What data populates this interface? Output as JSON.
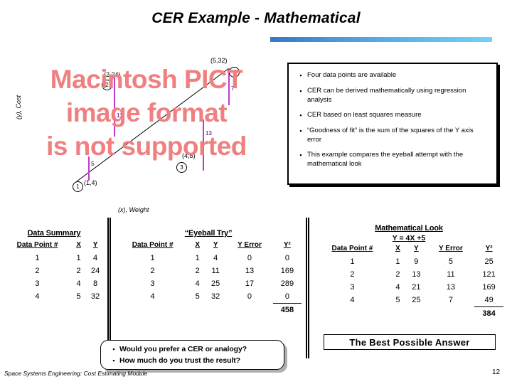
{
  "slide": {
    "title": "CER Example - Mathematical",
    "footer": "Space Systems Engineering: Cost Estimating Module",
    "page_number": "12",
    "accent_color_left": "#3478c4",
    "accent_color_right": "#74d2f6"
  },
  "chart_placeholder": {
    "line1": "Macintosh PICT",
    "line2": "image format",
    "line3": "is not supported",
    "color": "#f08080"
  },
  "chart_data": {
    "type": "scatter",
    "title": "",
    "xlabel": "(x), Weight",
    "ylabel": "(y), Cost",
    "x": [
      1,
      2,
      4,
      5
    ],
    "y": [
      4,
      24,
      8,
      32
    ],
    "point_labels": [
      "(1,4)",
      "(2,24)",
      "(4,8)",
      "(5,32)"
    ],
    "point_markers": [
      "1",
      "2",
      "3",
      "4"
    ],
    "error_bars": [
      5,
      11,
      13,
      7
    ],
    "error_bar_color": "#c03ad0",
    "trendline": {
      "slope": 4,
      "intercept": 5,
      "equation": "Y = 4X +5"
    },
    "grid": false,
    "legend": "none"
  },
  "bullets": {
    "marker": "▪",
    "items": [
      "Four data points are available",
      "CER can be derived mathematically using regression analysis",
      "CER based on least squares measure",
      "“Goodness of fit” is the sum of the squares of the Y axis error",
      "This example compares the eyeball attempt with the mathematical look"
    ]
  },
  "table_summary": {
    "title": "Data Summary",
    "headers": [
      "Data Point #",
      "X",
      "Y"
    ],
    "rows": [
      [
        "1",
        "1",
        "4"
      ],
      [
        "2",
        "2",
        "24"
      ],
      [
        "3",
        "4",
        "8"
      ],
      [
        "4",
        "5",
        "32"
      ]
    ]
  },
  "table_eyeball": {
    "title": "“Eyeball Try”",
    "headers": [
      "Data Point #",
      "X",
      "Y",
      "Y Error",
      "Y²"
    ],
    "rows": [
      [
        "1",
        "1",
        "4",
        "0",
        "0"
      ],
      [
        "2",
        "2",
        "11",
        "13",
        "169"
      ],
      [
        "3",
        "4",
        "25",
        "17",
        "289"
      ],
      [
        "4",
        "5",
        "32",
        "0",
        "0"
      ]
    ],
    "total": "458"
  },
  "table_mathematical": {
    "title": "Mathematical Look",
    "subtitle": "Y = 4X +5",
    "headers": [
      "Data Point #",
      "X",
      "Y",
      "Y Error",
      "Y²"
    ],
    "rows": [
      [
        "1",
        "1",
        "9",
        "5",
        "25"
      ],
      [
        "2",
        "2",
        "13",
        "11",
        "121"
      ],
      [
        "3",
        "4",
        "21",
        "13",
        "169"
      ],
      [
        "4",
        "5",
        "25",
        "7",
        "49"
      ]
    ],
    "total": "384",
    "best_answer": "The Best Possible Answer"
  },
  "callout": {
    "marker": "▪",
    "items": [
      "Would you prefer a CER or analogy?",
      "How much do you trust the result?"
    ]
  }
}
